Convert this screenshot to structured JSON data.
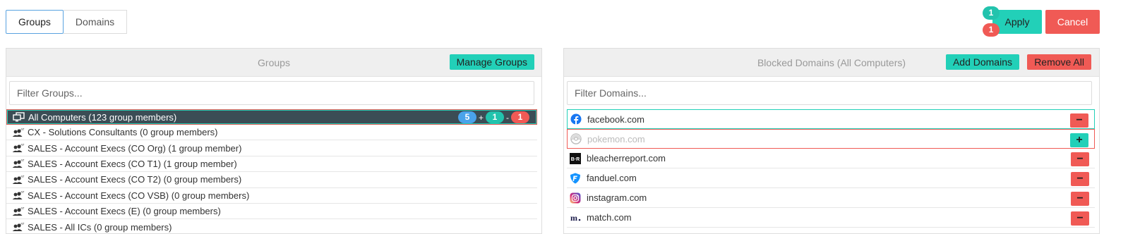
{
  "tabs": [
    {
      "label": "Groups",
      "active": true
    },
    {
      "label": "Domains",
      "active": false
    }
  ],
  "actions": {
    "apply_label": "Apply",
    "cancel_label": "Cancel",
    "pending_added": "1",
    "pending_removed": "1"
  },
  "groups_panel": {
    "title": "Groups",
    "manage_label": "Manage Groups",
    "filter_placeholder": "Filter Groups...",
    "items": [
      {
        "label": "All Computers (123 group members)",
        "icon": "computers-icon",
        "selected": true,
        "badges": {
          "total": "5",
          "added": "1",
          "removed": "1"
        }
      },
      {
        "label": "CX - Solutions Consultants (0 group members)",
        "icon": "users-group-icon"
      },
      {
        "label": "SALES - Account Execs (CO Org) (1 group member)",
        "icon": "users-group-icon"
      },
      {
        "label": "SALES - Account Execs (CO T1) (1 group member)",
        "icon": "users-group-icon"
      },
      {
        "label": "SALES - Account Execs (CO T2) (0 group members)",
        "icon": "users-group-icon"
      },
      {
        "label": "SALES - Account Execs (CO VSB) (0 group members)",
        "icon": "users-group-icon"
      },
      {
        "label": "SALES - Account Execs (E) (0 group members)",
        "icon": "users-group-icon"
      },
      {
        "label": "SALES - All ICs (0 group members)",
        "icon": "users-group-icon"
      }
    ]
  },
  "domains_panel": {
    "title": "Blocked Domains (All Computers)",
    "add_label": "Add Domains",
    "remove_all_label": "Remove All",
    "filter_placeholder": "Filter Domains...",
    "items": [
      {
        "domain": "facebook.com",
        "icon": "facebook-icon",
        "state": "added",
        "action": "−"
      },
      {
        "domain": "pokemon.com",
        "icon": "pokemon-icon",
        "state": "removed",
        "action": "+"
      },
      {
        "domain": "bleacherreport.com",
        "icon": "bleacherreport-icon",
        "state": "normal",
        "action": "−"
      },
      {
        "domain": "fanduel.com",
        "icon": "fanduel-icon",
        "state": "normal",
        "action": "−"
      },
      {
        "domain": "instagram.com",
        "icon": "instagram-icon",
        "state": "normal",
        "action": "−"
      },
      {
        "domain": "match.com",
        "icon": "match-icon",
        "state": "normal",
        "action": "−"
      }
    ]
  },
  "colors": {
    "accent_teal": "#22d0b8",
    "danger_red": "#f05a55",
    "info_blue": "#4aa3ea",
    "selected_row": "#3b4d55"
  }
}
